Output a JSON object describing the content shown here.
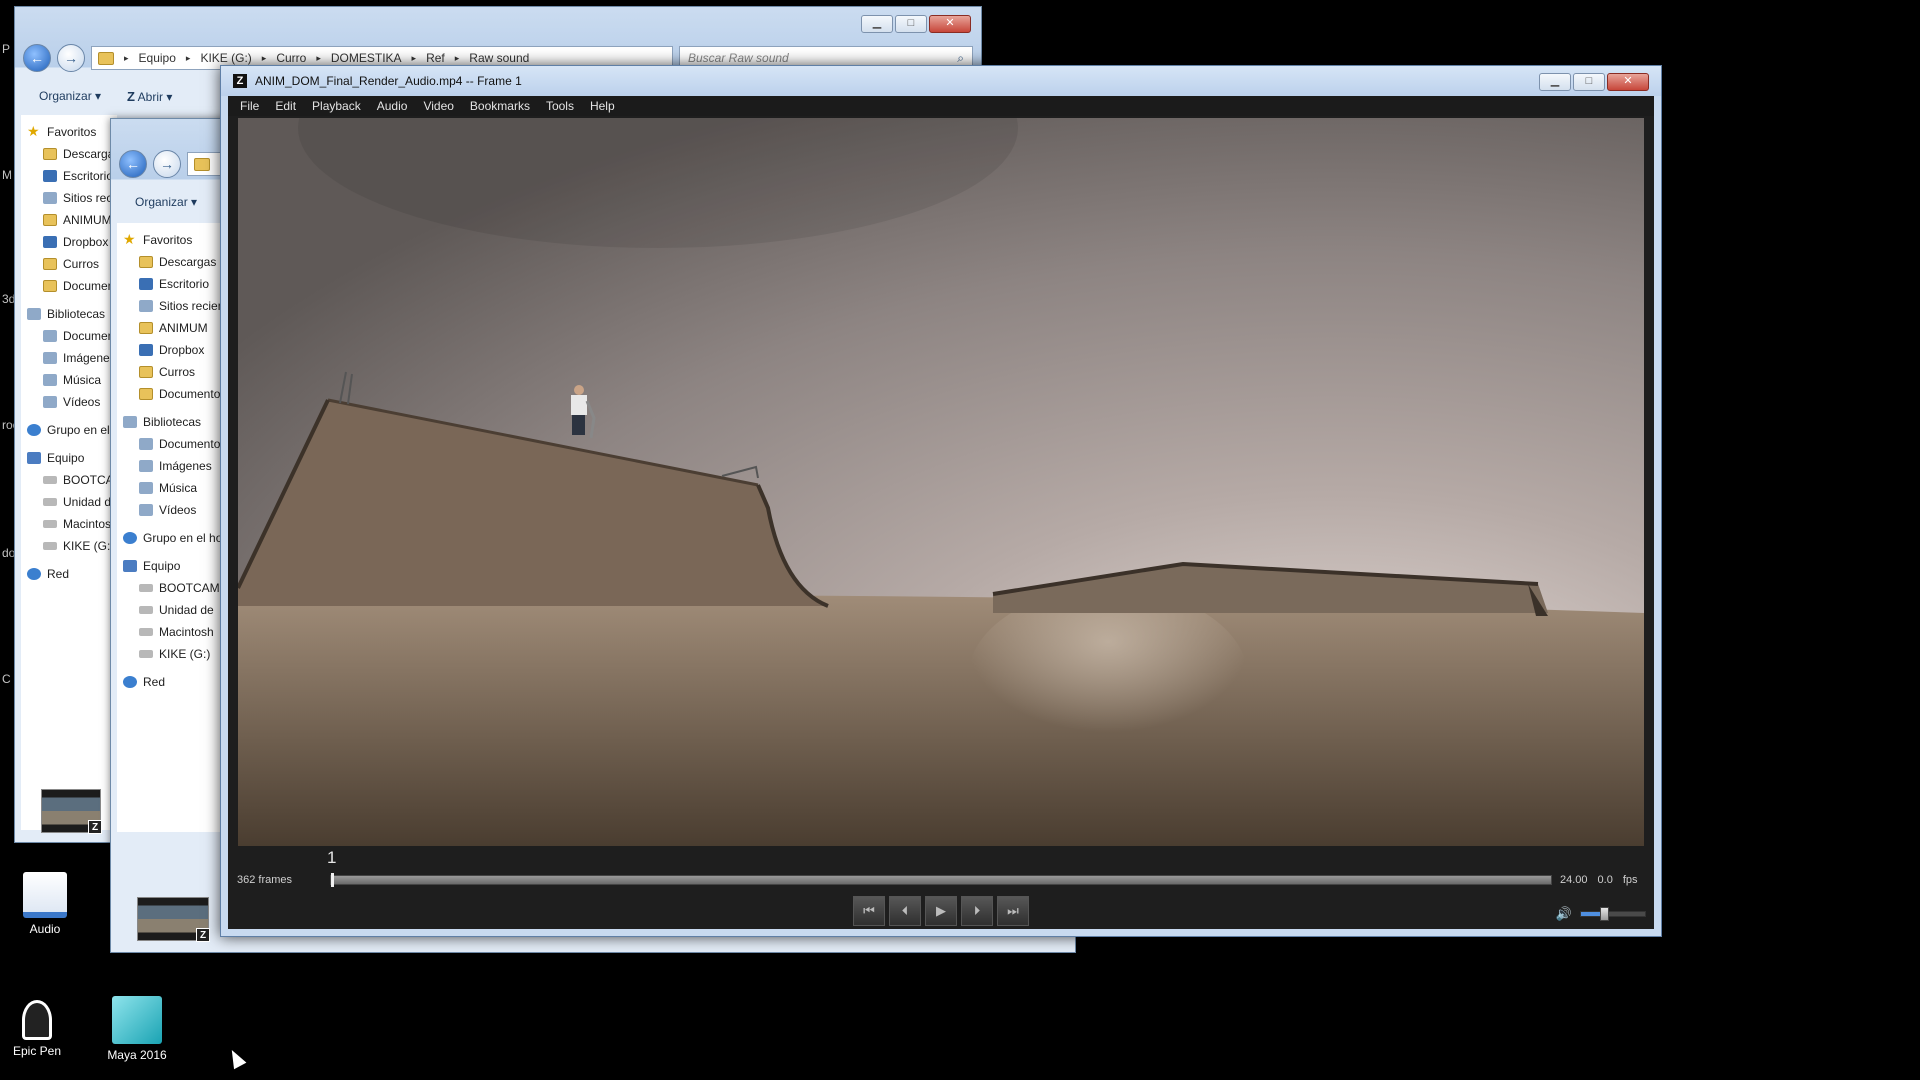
{
  "desktop": {
    "edge_letters": [
      "P",
      "M",
      "3d",
      "roc",
      "do",
      "C"
    ],
    "icons": [
      {
        "label": "Audio",
        "color": "#3b78c9"
      },
      {
        "label": "Epic Pen",
        "color": "#222222"
      },
      {
        "label": "Maya 2016",
        "color": "#1aa3b3"
      }
    ]
  },
  "explorer_back": {
    "breadcrumb": [
      "Equipo",
      "KIKE (G:)",
      "Curro",
      "DOMESTIKA",
      "Ref",
      "Raw sound"
    ],
    "search_placeholder": "Buscar Raw sound",
    "toolbar": {
      "organize": "Organizar ▾",
      "open": "Abrir ▾"
    },
    "nav_items": [
      {
        "label": "Favoritos",
        "icon": "star",
        "level": "top"
      },
      {
        "label": "Descargas",
        "icon": "folder",
        "level": "indent"
      },
      {
        "label": "Escritorio",
        "icon": "blue",
        "level": "indent"
      },
      {
        "label": "Sitios recientes",
        "icon": "lib",
        "level": "indent"
      },
      {
        "label": "ANIMUM",
        "icon": "folder",
        "level": "indent"
      },
      {
        "label": "Dropbox",
        "icon": "blue",
        "level": "indent"
      },
      {
        "label": "Curros",
        "icon": "folder",
        "level": "indent"
      },
      {
        "label": "Documentos",
        "icon": "folder",
        "level": "indent"
      },
      {
        "label": "Bibliotecas",
        "icon": "lib",
        "level": "top"
      },
      {
        "label": "Documentos",
        "icon": "lib",
        "level": "indent"
      },
      {
        "label": "Imágenes",
        "icon": "lib",
        "level": "indent"
      },
      {
        "label": "Música",
        "icon": "lib",
        "level": "indent"
      },
      {
        "label": "Vídeos",
        "icon": "lib",
        "level": "indent"
      },
      {
        "label": "Grupo en el hogar",
        "icon": "net",
        "level": "top"
      },
      {
        "label": "Equipo",
        "icon": "pc",
        "level": "top"
      },
      {
        "label": "BOOTCAMP",
        "icon": "disk",
        "level": "indent"
      },
      {
        "label": "Unidad de",
        "icon": "disk",
        "level": "indent"
      },
      {
        "label": "Macintosh",
        "icon": "disk",
        "level": "indent"
      },
      {
        "label": "KIKE (G:)",
        "icon": "disk",
        "level": "indent"
      },
      {
        "label": "Red",
        "icon": "net",
        "level": "top"
      }
    ]
  },
  "explorer_front": {
    "toolbar": {
      "organize": "Organizar ▾"
    },
    "nav_items": [
      {
        "label": "Favoritos",
        "icon": "star",
        "level": "top"
      },
      {
        "label": "Descargas",
        "icon": "folder",
        "level": "indent"
      },
      {
        "label": "Escritorio",
        "icon": "blue",
        "level": "indent"
      },
      {
        "label": "Sitios recientes",
        "icon": "lib",
        "level": "indent"
      },
      {
        "label": "ANIMUM",
        "icon": "folder",
        "level": "indent"
      },
      {
        "label": "Dropbox",
        "icon": "blue",
        "level": "indent"
      },
      {
        "label": "Curros",
        "icon": "folder",
        "level": "indent"
      },
      {
        "label": "Documentos",
        "icon": "folder",
        "level": "indent"
      },
      {
        "label": "Bibliotecas",
        "icon": "lib",
        "level": "top"
      },
      {
        "label": "Documentos",
        "icon": "lib",
        "level": "indent"
      },
      {
        "label": "Imágenes",
        "icon": "lib",
        "level": "indent"
      },
      {
        "label": "Música",
        "icon": "lib",
        "level": "indent"
      },
      {
        "label": "Vídeos",
        "icon": "lib",
        "level": "indent"
      },
      {
        "label": "Grupo en el hogar",
        "icon": "net",
        "level": "top"
      },
      {
        "label": "Equipo",
        "icon": "pc",
        "level": "top"
      },
      {
        "label": "BOOTCAMP",
        "icon": "disk",
        "level": "indent"
      },
      {
        "label": "Unidad de",
        "icon": "disk",
        "level": "indent"
      },
      {
        "label": "Macintosh",
        "icon": "disk",
        "level": "indent"
      },
      {
        "label": "KIKE (G:)",
        "icon": "disk",
        "level": "indent"
      },
      {
        "label": "Red",
        "icon": "net",
        "level": "top"
      }
    ]
  },
  "player": {
    "title": "ANIM_DOM_Final_Render_Audio.mp4 -- Frame 1",
    "menu": [
      "File",
      "Edit",
      "Playback",
      "Audio",
      "Video",
      "Bookmarks",
      "Tools",
      "Help"
    ],
    "current_frame": "1",
    "frames_label": "362 frames",
    "playhead_fraction": 0.0,
    "fps_value": "24.00",
    "extra_value": "0.0",
    "fps_unit": "fps",
    "controls": [
      {
        "name": "go-to-start",
        "glyph": "⏮"
      },
      {
        "name": "step-back",
        "glyph": "⏴"
      },
      {
        "name": "play",
        "glyph": "▶"
      },
      {
        "name": "step-forward",
        "glyph": "⏵"
      },
      {
        "name": "go-to-end",
        "glyph": "⏭"
      }
    ],
    "volume_icon": "🔊",
    "volume_fraction": 0.35,
    "colors": {
      "accent": "#4f8fe0",
      "chrome": "#1e1e1e"
    }
  }
}
